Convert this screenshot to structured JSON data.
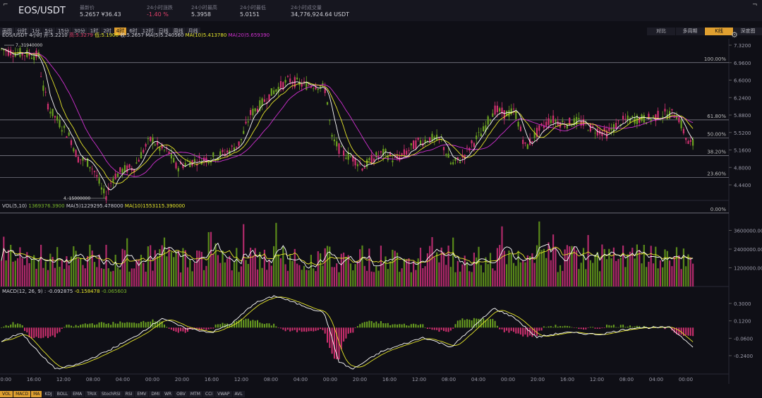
{
  "header": {
    "pair": "EOS/USDT",
    "stats": [
      {
        "label": "最新价",
        "value": "5.2657 ¥36.43",
        "color": "#d0d0d8"
      },
      {
        "label": "24小时涨跌",
        "value": "-1.40 %",
        "color": "#e0406a"
      },
      {
        "label": "24小时最高",
        "value": "5.3958",
        "color": "#d0d0d8"
      },
      {
        "label": "24小时最低",
        "value": "5.0151",
        "color": "#d0d0d8"
      },
      {
        "label": "24小时成交量",
        "value": "34,776,924.64 USDT",
        "color": "#d0d0d8"
      }
    ]
  },
  "timeframes": [
    "画图",
    "分时",
    "1分",
    "5分",
    "15分",
    "30分",
    "1时",
    "2时",
    "4时",
    "6时",
    "12时",
    "日线",
    "周线",
    "月线"
  ],
  "timeframe_active": "4时",
  "right_tabs": [
    "对比",
    "多周期",
    "K线",
    "深度图"
  ],
  "right_tab_active": "K线",
  "ohlc": {
    "pair": "EOS/USDT",
    "period": "4小时",
    "open_label": "开:",
    "open": "5.2210",
    "high_label": "高:",
    "high": "5.3279",
    "low_label": "低:",
    "low": "5.1906",
    "close_label": "收:",
    "close": "5.2657",
    "ma5_label": "MA(5)",
    "ma5": "5.240560",
    "ma10_label": "MA(10)",
    "ma10": "5.413780",
    "ma20_label": "MA(20)",
    "ma20": "5.659390"
  },
  "vol": {
    "label": "VOL(5,10)",
    "value": "1369376.3900",
    "ma5_label": "MA(5)",
    "ma5": "1229295.478000",
    "ma10_label": "MA(10)",
    "ma10": "1553115.390000"
  },
  "macd": {
    "label": "MACD(12, 26, 9) :",
    "dif": "-0.092875",
    "dea": "-0.158478",
    "hist": "-0.065603"
  },
  "price_axis": [
    "7.3200",
    "6.9600",
    "6.6000",
    "6.2400",
    "5.8800",
    "5.5200",
    "5.1600",
    "4.8000",
    "4.4400"
  ],
  "vol_axis": [
    "3600000.00",
    "2400000.00",
    "1200000.00"
  ],
  "macd_axis": [
    "0.3000",
    "0.1200",
    "-0.0600",
    "-0.2400"
  ],
  "fib_levels": [
    {
      "label": "100.00%",
      "value": 6.96
    },
    {
      "label": "61.80%",
      "value": 5.78
    },
    {
      "label": "50.00%",
      "value": 5.41
    },
    {
      "label": "38.20%",
      "value": 5.045
    },
    {
      "label": "23.60%",
      "value": 4.59
    },
    {
      "label": "0.00%",
      "value": 3.86
    }
  ],
  "hi_marker": "7. 31940000",
  "lo_marker": "4. 15000000",
  "time_axis": [
    "00:00",
    "16:00",
    "12:00",
    "08:00",
    "04:00",
    "00:00",
    "20:00",
    "16:00",
    "12:00",
    "08:00",
    "04:00",
    "00:00",
    "20:00",
    "16:00",
    "12:00",
    "08:00",
    "04:00",
    "00:00",
    "20:00",
    "16:00",
    "12:00",
    "08:00",
    "04:00",
    "00:00"
  ],
  "indicators": [
    "VOL",
    "MACD",
    "MA",
    "KDJ",
    "BOLL",
    "EMA",
    "TRIX",
    "StochRSI",
    "RSI",
    "EMV",
    "DMI",
    "WR",
    "OBV",
    "MTM",
    "CCI",
    "VWAP",
    "AVL"
  ],
  "indicators_active": [
    "VOL",
    "MACD",
    "MA"
  ],
  "colors": {
    "up": "#5a8a1a",
    "down": "#c0306a",
    "ma5": "#ffffff",
    "ma10": "#e6e62a",
    "ma20": "#d030d0",
    "accent": "#e0a030"
  },
  "price_keypoints": [
    [
      0,
      7.25
    ],
    [
      10,
      7.2
    ],
    [
      30,
      7.15
    ],
    [
      55,
      7.1
    ],
    [
      60,
      6.5
    ],
    [
      70,
      6.0
    ],
    [
      85,
      5.7
    ],
    [
      100,
      5.4
    ],
    [
      110,
      5.0
    ],
    [
      125,
      4.9
    ],
    [
      135,
      4.7
    ],
    [
      145,
      4.3
    ],
    [
      150,
      4.2
    ],
    [
      160,
      4.6
    ],
    [
      175,
      4.75
    ],
    [
      190,
      4.8
    ],
    [
      205,
      5.2
    ],
    [
      215,
      5.4
    ],
    [
      225,
      5.2
    ],
    [
      240,
      5.1
    ],
    [
      250,
      4.8
    ],
    [
      265,
      4.9
    ],
    [
      280,
      4.95
    ],
    [
      300,
      5.0
    ],
    [
      320,
      5.1
    ],
    [
      340,
      5.3
    ],
    [
      355,
      5.9
    ],
    [
      370,
      6.1
    ],
    [
      390,
      6.4
    ],
    [
      410,
      6.6
    ],
    [
      430,
      6.5
    ],
    [
      450,
      6.5
    ],
    [
      462,
      6.4
    ],
    [
      470,
      5.4
    ],
    [
      485,
      5.1
    ],
    [
      500,
      5.0
    ],
    [
      515,
      4.8
    ],
    [
      530,
      5.0
    ],
    [
      545,
      5.1
    ],
    [
      560,
      4.95
    ],
    [
      575,
      5.1
    ],
    [
      590,
      5.3
    ],
    [
      610,
      5.4
    ],
    [
      625,
      5.35
    ],
    [
      640,
      4.85
    ],
    [
      655,
      5.0
    ],
    [
      670,
      5.3
    ],
    [
      685,
      5.55
    ],
    [
      700,
      6.0
    ],
    [
      715,
      5.9
    ],
    [
      730,
      5.95
    ],
    [
      745,
      5.2
    ],
    [
      760,
      5.5
    ],
    [
      780,
      5.8
    ],
    [
      800,
      5.7
    ],
    [
      820,
      5.75
    ],
    [
      840,
      5.6
    ],
    [
      860,
      5.5
    ],
    [
      880,
      5.75
    ],
    [
      900,
      5.8
    ],
    [
      920,
      5.8
    ],
    [
      940,
      5.9
    ],
    [
      960,
      5.9
    ],
    [
      975,
      5.3
    ],
    [
      985,
      5.27
    ]
  ],
  "macd_keypoints": [
    [
      0,
      -0.1
    ],
    [
      30,
      0.0
    ],
    [
      60,
      -0.25
    ],
    [
      80,
      -0.38
    ],
    [
      110,
      -0.33
    ],
    [
      150,
      -0.2
    ],
    [
      190,
      -0.05
    ],
    [
      230,
      0.15
    ],
    [
      260,
      0.05
    ],
    [
      300,
      0.0
    ],
    [
      330,
      0.1
    ],
    [
      360,
      0.3
    ],
    [
      390,
      0.38
    ],
    [
      420,
      0.3
    ],
    [
      460,
      0.2
    ],
    [
      480,
      -0.3
    ],
    [
      500,
      -0.38
    ],
    [
      540,
      -0.2
    ],
    [
      600,
      -0.05
    ],
    [
      640,
      -0.15
    ],
    [
      670,
      0.05
    ],
    [
      700,
      0.25
    ],
    [
      730,
      0.15
    ],
    [
      760,
      -0.05
    ],
    [
      800,
      0.0
    ],
    [
      850,
      -0.02
    ],
    [
      900,
      0.05
    ],
    [
      950,
      0.05
    ],
    [
      985,
      -0.16
    ]
  ]
}
